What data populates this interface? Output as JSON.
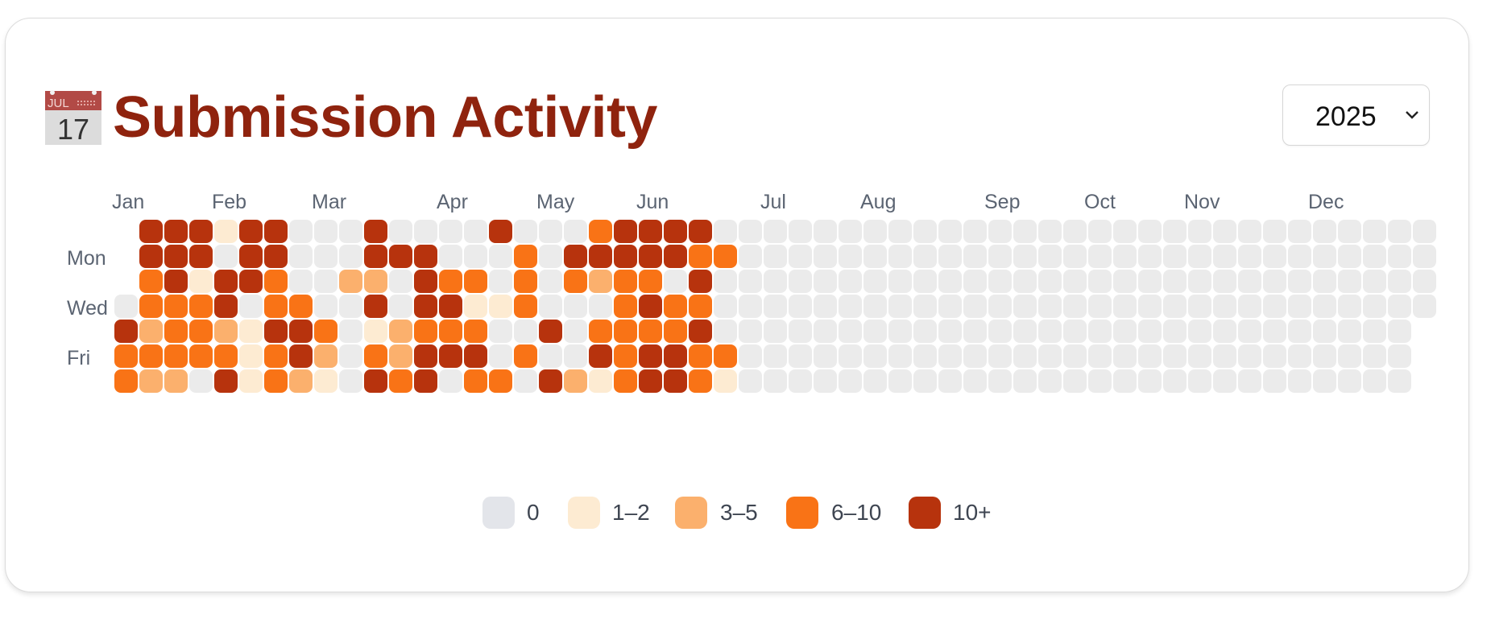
{
  "title": "Submission Activity",
  "icon": {
    "name": "calendar-icon",
    "month": "JUL",
    "day": "17"
  },
  "year_select": {
    "value": "2025"
  },
  "months": [
    "Jan",
    "Feb",
    "Mar",
    "Apr",
    "May",
    "Jun",
    "Jul",
    "Aug",
    "Sep",
    "Oct",
    "Nov",
    "Dec"
  ],
  "day_labels": [
    "Mon",
    "Wed",
    "Fri"
  ],
  "legend": [
    {
      "label": "0",
      "color": "#e3e5ea"
    },
    {
      "label": "1–2",
      "color": "#fdebd2"
    },
    {
      "label": "3–5",
      "color": "#fbb06d"
    },
    {
      "label": "6–10",
      "color": "#f97316"
    },
    {
      "label": "10+",
      "color": "#b7330d"
    }
  ],
  "colors": {
    "empty": "#ebebeb",
    "title": "#8f230e"
  },
  "heatmap": {
    "week_start_day": "Sunday",
    "rows_sun_to_sat": [
      ".44414400040000400034444.",
      ".444044000444000304444433",
      ".341443002204330303233.4.",
      ".33340330040441130003433.",
      "423321443012333004033334.",
      "3333313420324440300434433",
      "3220413210434033042134431."
    ]
  }
}
